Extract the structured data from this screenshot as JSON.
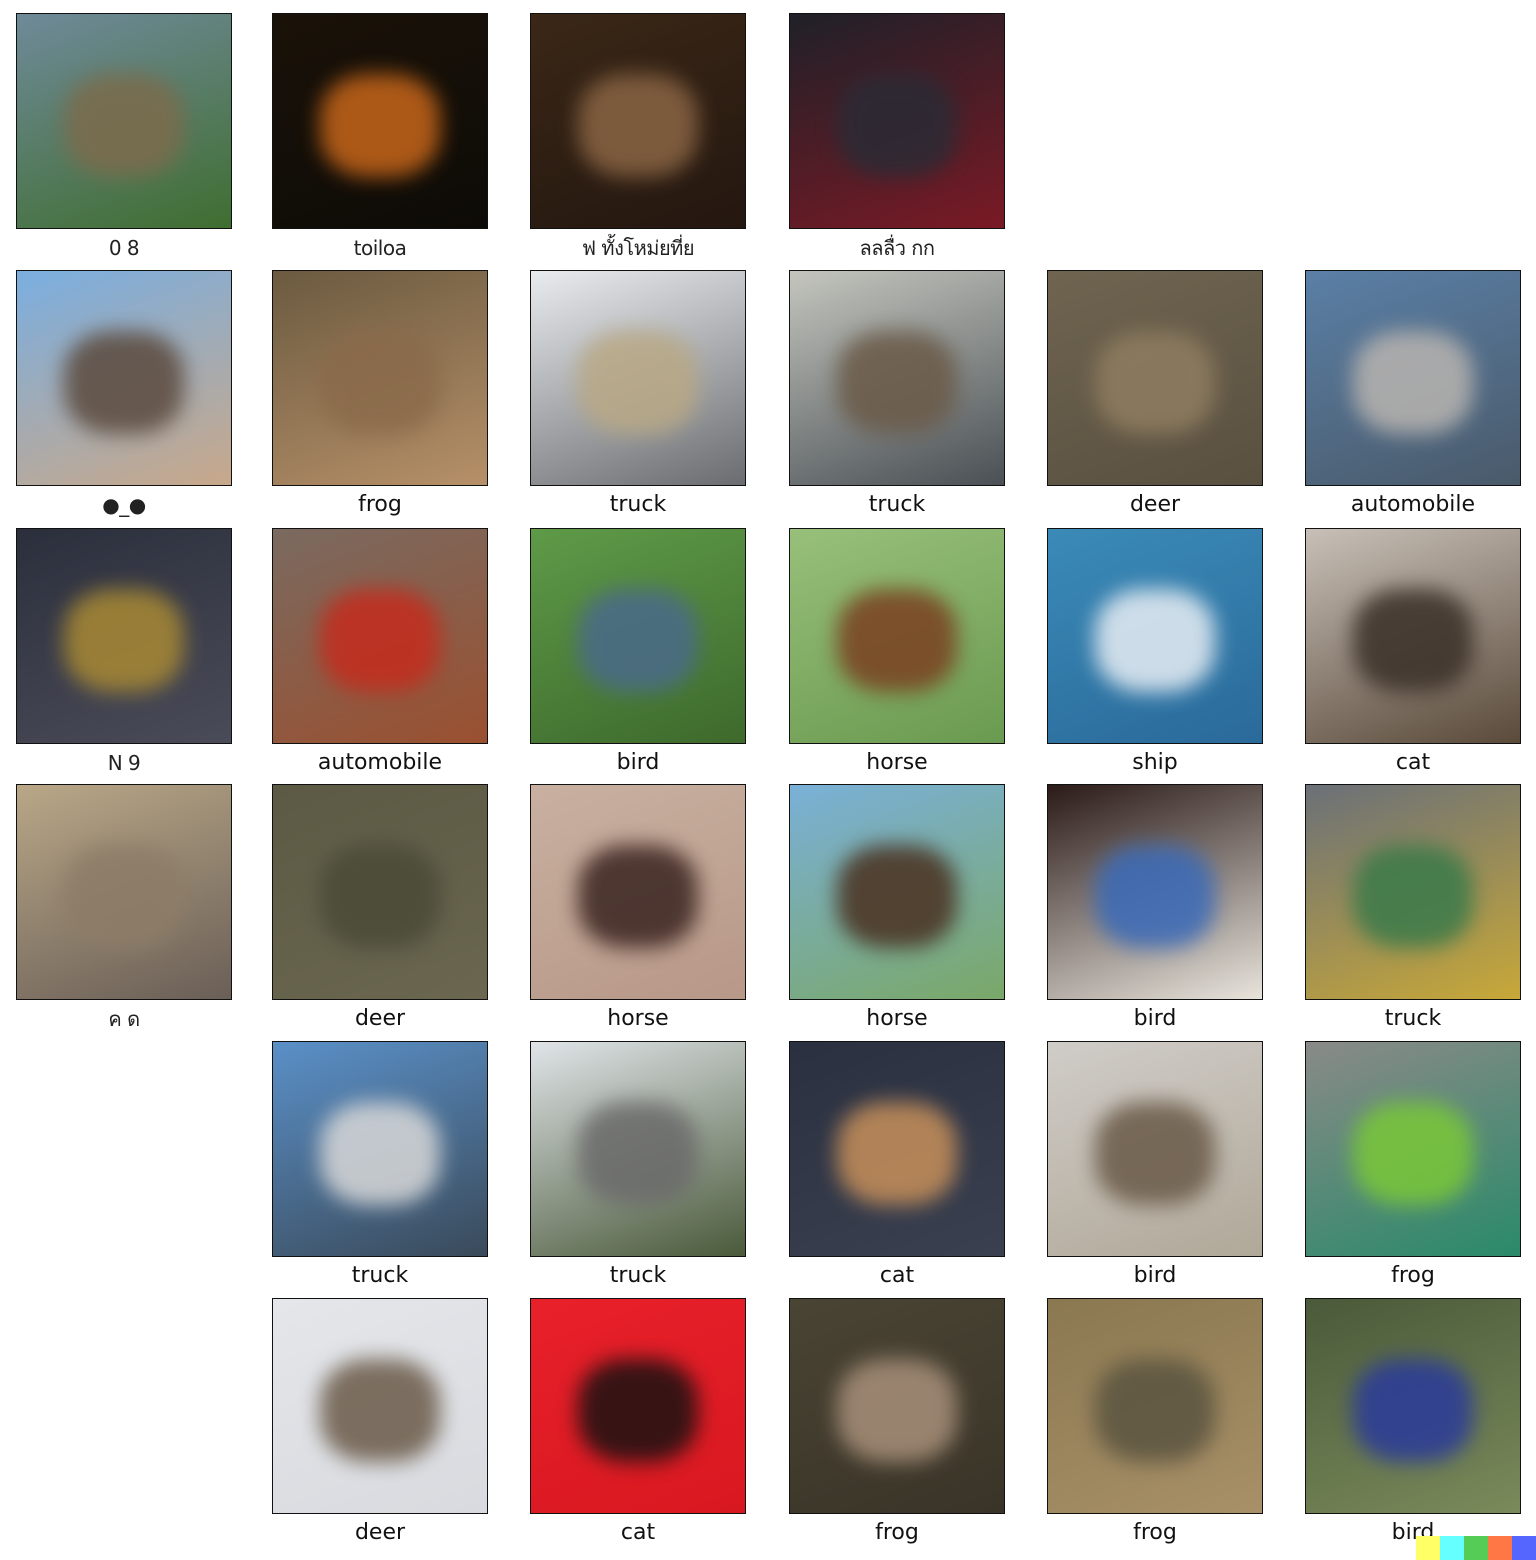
{
  "grid": {
    "col0": [
      {
        "label": "0 8",
        "colors": [
          "#6f8a9a",
          "#7c6b4c",
          "#3f6e30"
        ]
      },
      {
        "label": "●_●",
        "colors": [
          "#7aaee0",
          "#5b4a3e",
          "#c8a88a"
        ]
      },
      {
        "label": "N 9",
        "colors": [
          "#2b2f3c",
          "#a88934",
          "#4a4b58"
        ]
      },
      {
        "label": "ค ด",
        "colors": [
          "#b9a787",
          "#8d7c67",
          "#6a5f57"
        ]
      }
    ],
    "row0": [
      {
        "label": "toiloa",
        "colors": [
          "#1a1208",
          "#c7661a",
          "#0d0b07"
        ]
      },
      {
        "label": "ฟ ทั้งโหม่ยที่ย",
        "colors": [
          "#3a2716",
          "#8a6544",
          "#241710"
        ]
      },
      {
        "label": "ลลลื่ว กก",
        "colors": [
          "#1f2028",
          "#2a2b35",
          "#7a1a25"
        ]
      }
    ],
    "rows": [
      [
        {
          "label": "frog",
          "colors": [
            "#6b5a40",
            "#8a6a4a",
            "#b69068"
          ]
        },
        {
          "label": "truck",
          "colors": [
            "#e9ecef",
            "#b9a884",
            "#6a6c70"
          ]
        },
        {
          "label": "truck",
          "colors": [
            "#c4c6be",
            "#6a5a48",
            "#4a5055"
          ]
        },
        {
          "label": "deer",
          "colors": [
            "#6e6450",
            "#8f7d60",
            "#5a5040"
          ]
        },
        {
          "label": "automobile",
          "colors": [
            "#5a7fa6",
            "#b8b4b0",
            "#4a5a6a"
          ]
        }
      ],
      [
        {
          "label": "automobile",
          "colors": [
            "#7a6a60",
            "#c42c1e",
            "#9a5030"
          ]
        },
        {
          "label": "bird",
          "colors": [
            "#5e9a48",
            "#4a6a8a",
            "#3e6a2c"
          ]
        },
        {
          "label": "horse",
          "colors": [
            "#98c07a",
            "#7a4020",
            "#6a9a50"
          ]
        },
        {
          "label": "ship",
          "colors": [
            "#3a8ab8",
            "#e8eef4",
            "#2a6a9a"
          ]
        },
        {
          "label": "cat",
          "colors": [
            "#c8c0b8",
            "#3a3028",
            "#5a4a3a"
          ]
        }
      ],
      [
        {
          "label": "deer",
          "colors": [
            "#5c5a44",
            "#4a4a38",
            "#6a6650"
          ]
        },
        {
          "label": "horse",
          "colors": [
            "#c8b0a0",
            "#3a2420",
            "#b89888"
          ]
        },
        {
          "label": "horse",
          "colors": [
            "#7ab0d8",
            "#4a3020",
            "#7aa868"
          ]
        },
        {
          "label": "bird",
          "colors": [
            "#2a1a18",
            "#3a6ab8",
            "#e8e4dc"
          ]
        },
        {
          "label": "truck",
          "colors": [
            "#6a7078",
            "#3a7a4a",
            "#c8a838"
          ]
        }
      ],
      [
        {
          "label": "truck",
          "colors": [
            "#5a90c8",
            "#d8d8d8",
            "#3a4a5a"
          ]
        },
        {
          "label": "truck",
          "colors": [
            "#e0e4e8",
            "#6a6a6a",
            "#4a5a3a"
          ]
        },
        {
          "label": "cat",
          "colors": [
            "#2a3040",
            "#c8905a",
            "#3a4050"
          ]
        },
        {
          "label": "bird",
          "colors": [
            "#d0ccc8",
            "#6a5a48",
            "#b0a898"
          ]
        },
        {
          "label": "frog",
          "colors": [
            "#8a8a88",
            "#7ac838",
            "#2a8a6a"
          ]
        }
      ],
      [
        {
          "label": "deer",
          "colors": [
            "#e4e6ea",
            "#6a5a48",
            "#d8dadf"
          ]
        },
        {
          "label": "cat",
          "colors": [
            "#e8202a",
            "#1a1212",
            "#d81820"
          ]
        },
        {
          "label": "frog",
          "colors": [
            "#4a4434",
            "#a8907a",
            "#3a3428"
          ]
        },
        {
          "label": "frog",
          "colors": [
            "#8a7850",
            "#5a5440",
            "#a89068"
          ]
        },
        {
          "label": "bird",
          "colors": [
            "#4a5a3a",
            "#2a3a9a",
            "#7a8a5a"
          ]
        }
      ]
    ]
  },
  "strip_colors": [
    "#ffff66",
    "#66ffff",
    "#55cc55",
    "#ff7744",
    "#5566ff"
  ]
}
